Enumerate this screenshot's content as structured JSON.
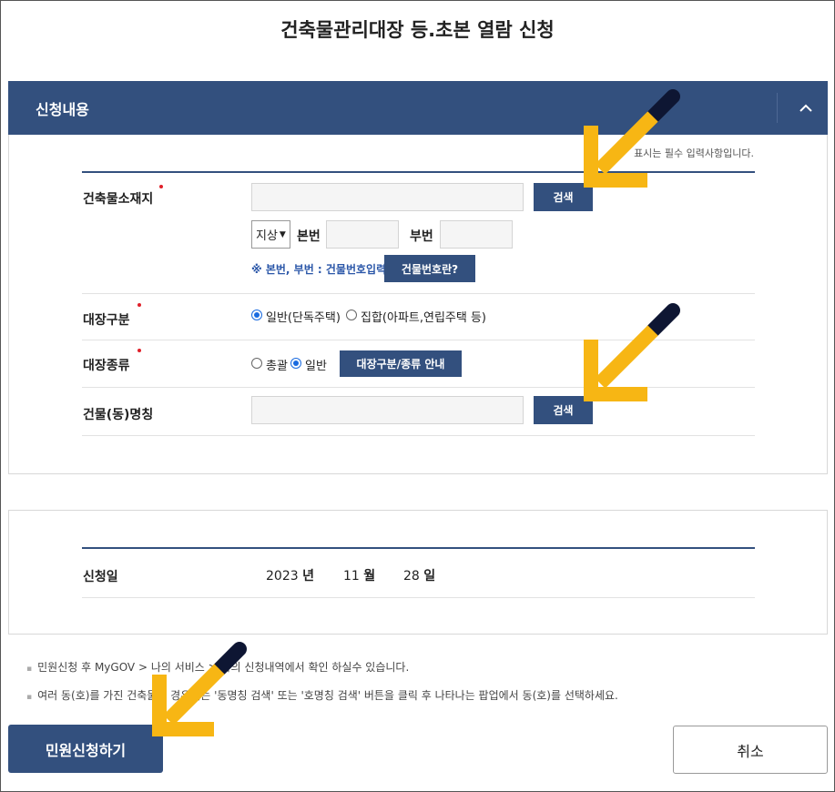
{
  "page": {
    "title": "건축물관리대장 등.초본 열람 신청"
  },
  "section": {
    "title": "신청내용",
    "toggle_icon": "chevron-up-icon",
    "required_note": "표시는 필수 입력사항입니다."
  },
  "form": {
    "address_label": "건축물소재지",
    "address_value": "",
    "search_label": "검색",
    "land_type_value": "지상",
    "main_number_label": "본번",
    "main_number_value": "",
    "sub_number_label": "부번",
    "sub_number_value": "",
    "number_hint": "※ 본번, 부번 : 건물번호입력",
    "building_number_button": "건물번호란?",
    "ledger_type_label": "대장구분",
    "ledger_type_options": [
      "일반(단독주택)",
      "집합(아파트,연립주택 등)"
    ],
    "ledger_type_selected": "일반(단독주택)",
    "ledger_kind_label": "대장종류",
    "ledger_kind_options": [
      "총괄",
      "일반"
    ],
    "ledger_kind_selected": "일반",
    "guide_button": "대장구분/종류 안내",
    "building_name_label": "건물(동)명칭",
    "building_name_value": "",
    "building_search_label": "검색"
  },
  "date": {
    "label": "신청일",
    "year": "2023",
    "year_unit": "년",
    "month": "11",
    "month_unit": "월",
    "day": "28",
    "day_unit": "일"
  },
  "notes": [
    "민원신청 후 MyGOV > 나의 서비스 > 나의 신청내역에서 확인 하실수 있습니다.",
    "여러 동(호)를 가진 건축물인 경우에는 '동명칭 검색' 또는 '호명칭 검색' 버튼을 클릭 후 나타나는 팝업에서 동(호)를 선택하세요."
  ],
  "actions": {
    "submit": "민원신청하기",
    "cancel": "취소"
  },
  "colors": {
    "navy": "#33507e",
    "arrow": "#f7b614",
    "required": "#e0202a"
  }
}
